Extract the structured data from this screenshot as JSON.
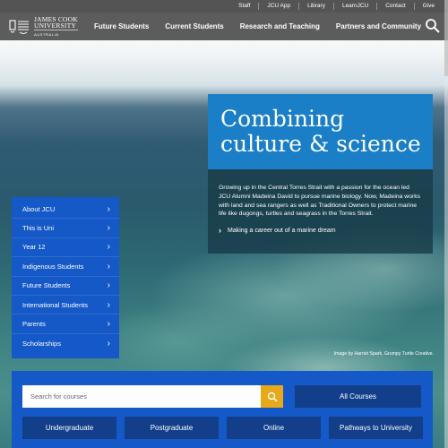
{
  "utility_nav": [
    "Staff",
    "JCU App",
    "Library",
    "LearnJCU",
    "Contact",
    "Give"
  ],
  "logo": {
    "line1": "JAMES COOK",
    "line2": "UNIVERSITY",
    "line3": "AUSTRALIA"
  },
  "main_nav": [
    "Future Students",
    "Current Students",
    "Research and Teaching",
    "Partners and Community"
  ],
  "feature": {
    "title_line1": "Combining",
    "title_line2": "culture & science",
    "body": "Growing up in the Central Torres Strait with a passion for the ocean led JCU Alumni Madeina David to pursue marine biology. Now, Madeina works with land and sea rangers as well as Traditional Owners to protect marine life like dugongs, turtles and seagrass in the Torres Strait.",
    "link": "Making a career out of a marine dream"
  },
  "side_menu": [
    "About JCU",
    "This is Uni",
    "Year 12",
    "Indigenous Students",
    "Future Students",
    "International Students",
    "Parents",
    "Scholarships"
  ],
  "image_credit": "Image by Harriet Spark, Grumpy Turtle Creative.",
  "course_search": {
    "placeholder": "Search for courses",
    "all_courses": "All Courses",
    "levels": [
      "Undergraduate",
      "Postgraduate",
      "Online",
      "Pathways to University"
    ]
  },
  "colors": {
    "brand_blue": "#1558c8",
    "feature_blue": "#1a7fc7",
    "dark_blue": "#123e8a",
    "search_gold": "#e9a71a",
    "nav_grey": "#464646"
  },
  "icons": {
    "search": "search-icon",
    "chevron": "chevron-right-icon"
  }
}
